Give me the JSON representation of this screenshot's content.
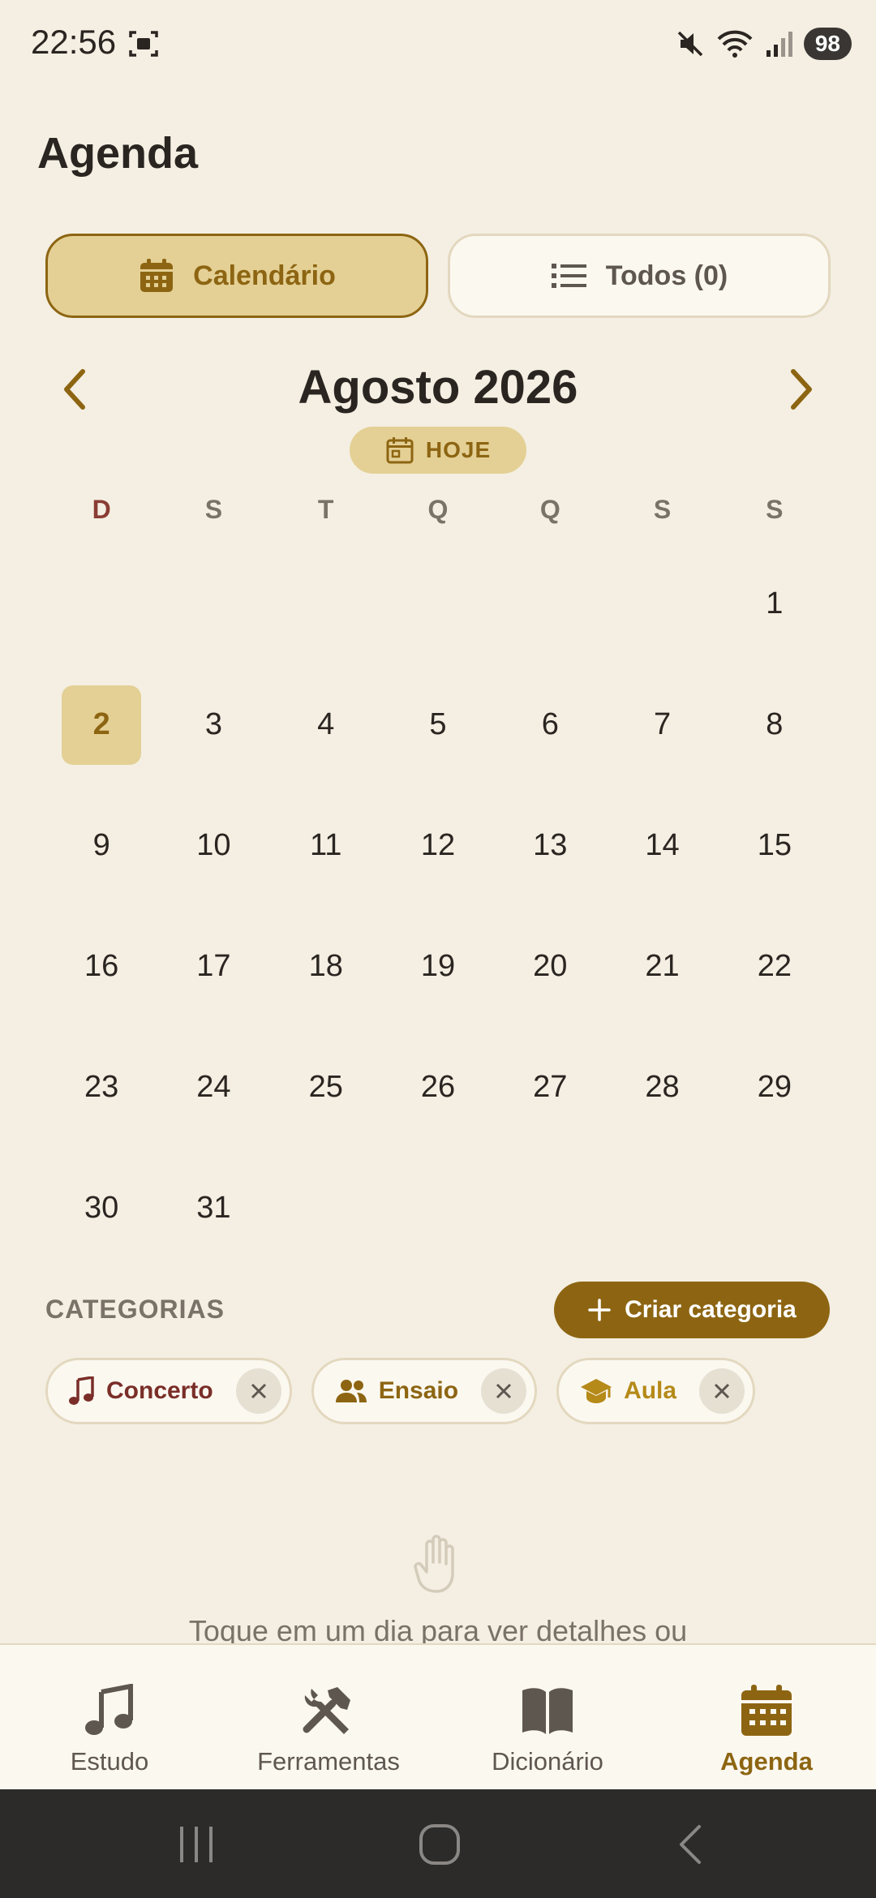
{
  "status_bar": {
    "time": "22:56",
    "battery": "98"
  },
  "page": {
    "title": "Agenda"
  },
  "view_toggle": {
    "calendar_label": "Calendário",
    "all_label": "Todos (0)"
  },
  "calendar": {
    "month_title": "Agosto 2026",
    "today_label": "HOJE",
    "weekdays": [
      "D",
      "S",
      "T",
      "Q",
      "Q",
      "S",
      "S"
    ],
    "days": [
      "1",
      "2",
      "3",
      "4",
      "5",
      "6",
      "7",
      "8",
      "9",
      "10",
      "11",
      "12",
      "13",
      "14",
      "15",
      "16",
      "17",
      "18",
      "19",
      "20",
      "21",
      "22",
      "23",
      "24",
      "25",
      "26",
      "27",
      "28",
      "29",
      "30",
      "31"
    ],
    "selected_day": "2"
  },
  "categories": {
    "title": "CATEGORIAS",
    "create_label": "Criar categoria",
    "items": [
      {
        "label": "Concerto",
        "icon": "music-note-icon",
        "color": "#7a2e28"
      },
      {
        "label": "Ensaio",
        "icon": "people-icon",
        "color": "#8d6512"
      },
      {
        "label": "Aula",
        "icon": "graduation-cap-icon",
        "color": "#b58a18"
      }
    ]
  },
  "empty_state": {
    "hint": "Toque em um dia para ver detalhes ou"
  },
  "bottom_nav": {
    "items": [
      {
        "label": "Estudo",
        "icon": "music-note-icon"
      },
      {
        "label": "Ferramentas",
        "icon": "tools-icon"
      },
      {
        "label": "Dicionário",
        "icon": "book-icon"
      },
      {
        "label": "Agenda",
        "icon": "calendar-icon"
      }
    ],
    "active": "Agenda"
  },
  "colors": {
    "accent": "#8d6512",
    "accent_light": "#e4d095",
    "background": "#f4efe2"
  }
}
